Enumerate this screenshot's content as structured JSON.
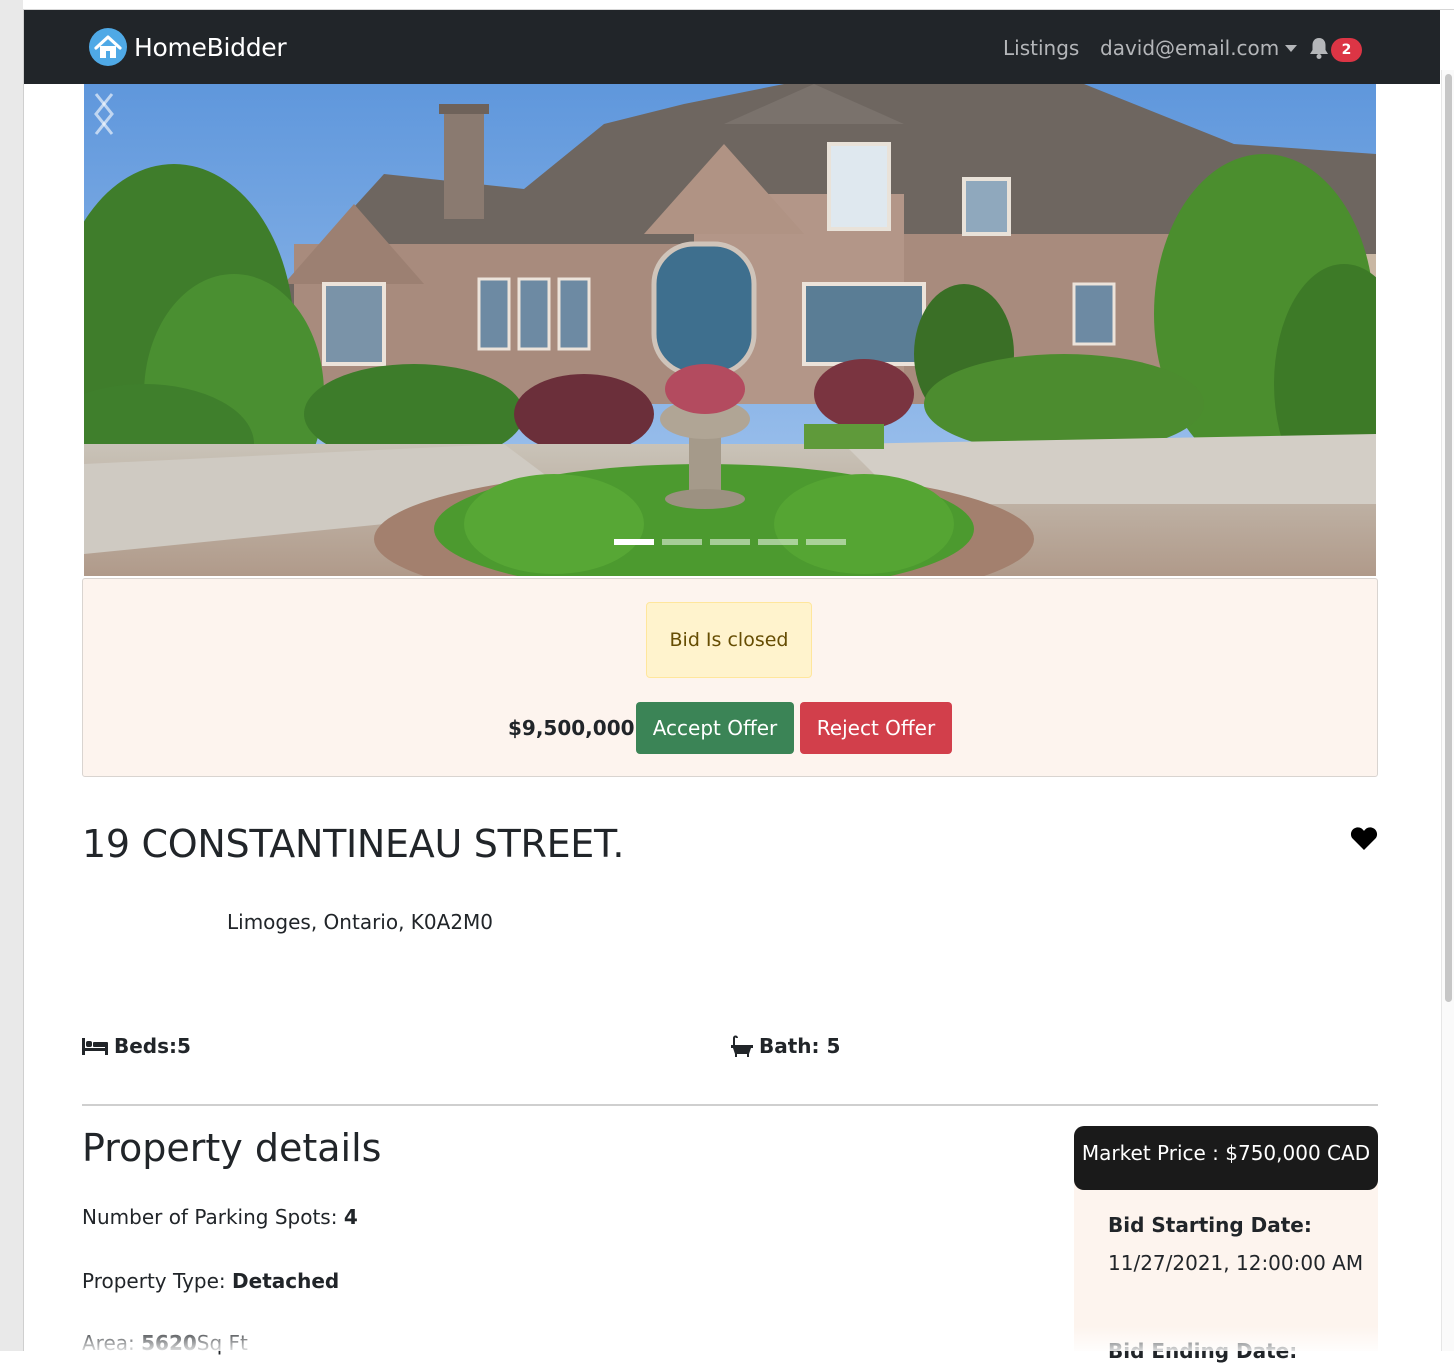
{
  "navbar": {
    "brand": "HomeBidder",
    "listings_label": "Listings",
    "user_email": "david@email.com",
    "notification_count": "2",
    "icons": {
      "logo": "house-logo-icon",
      "caret": "caret-down-icon",
      "bell": "bell-icon"
    }
  },
  "carousel": {
    "slide_count": 5,
    "active_index": 0,
    "prev_icon": "chevron-left-icon",
    "next_icon": "chevron-right-icon"
  },
  "bid_panel": {
    "status": "Bid Is closed",
    "amount": "$9,500,000",
    "accept_label": "Accept Offer",
    "reject_label": "Reject Offer",
    "colors": {
      "accept": "#3b8456",
      "reject": "#d23f4b",
      "alert_bg": "#fff3cd"
    }
  },
  "property": {
    "address": "19 CONSTANTINEAU STREET.",
    "city_line": "Limoges, Ontario, K0A2M0",
    "beds": "Beds:5",
    "bath": "Bath: 5",
    "favorite_icon": "heart-icon"
  },
  "details": {
    "heading": "Property details",
    "parking_label": "Number of Parking Spots: ",
    "parking_value": "4",
    "type_label": "Property Type: ",
    "type_value": "Detached",
    "area_label": "Area: ",
    "area_value": "5620",
    "area_unit": "Sq Ft"
  },
  "sidebar": {
    "market_price": "Market Price : $750,000 CAD",
    "bid_start_label": "Bid Starting Date:",
    "bid_start_value": "11/27/2021, 12:00:00 AM",
    "bid_end_label": "Bid Ending Date:"
  }
}
